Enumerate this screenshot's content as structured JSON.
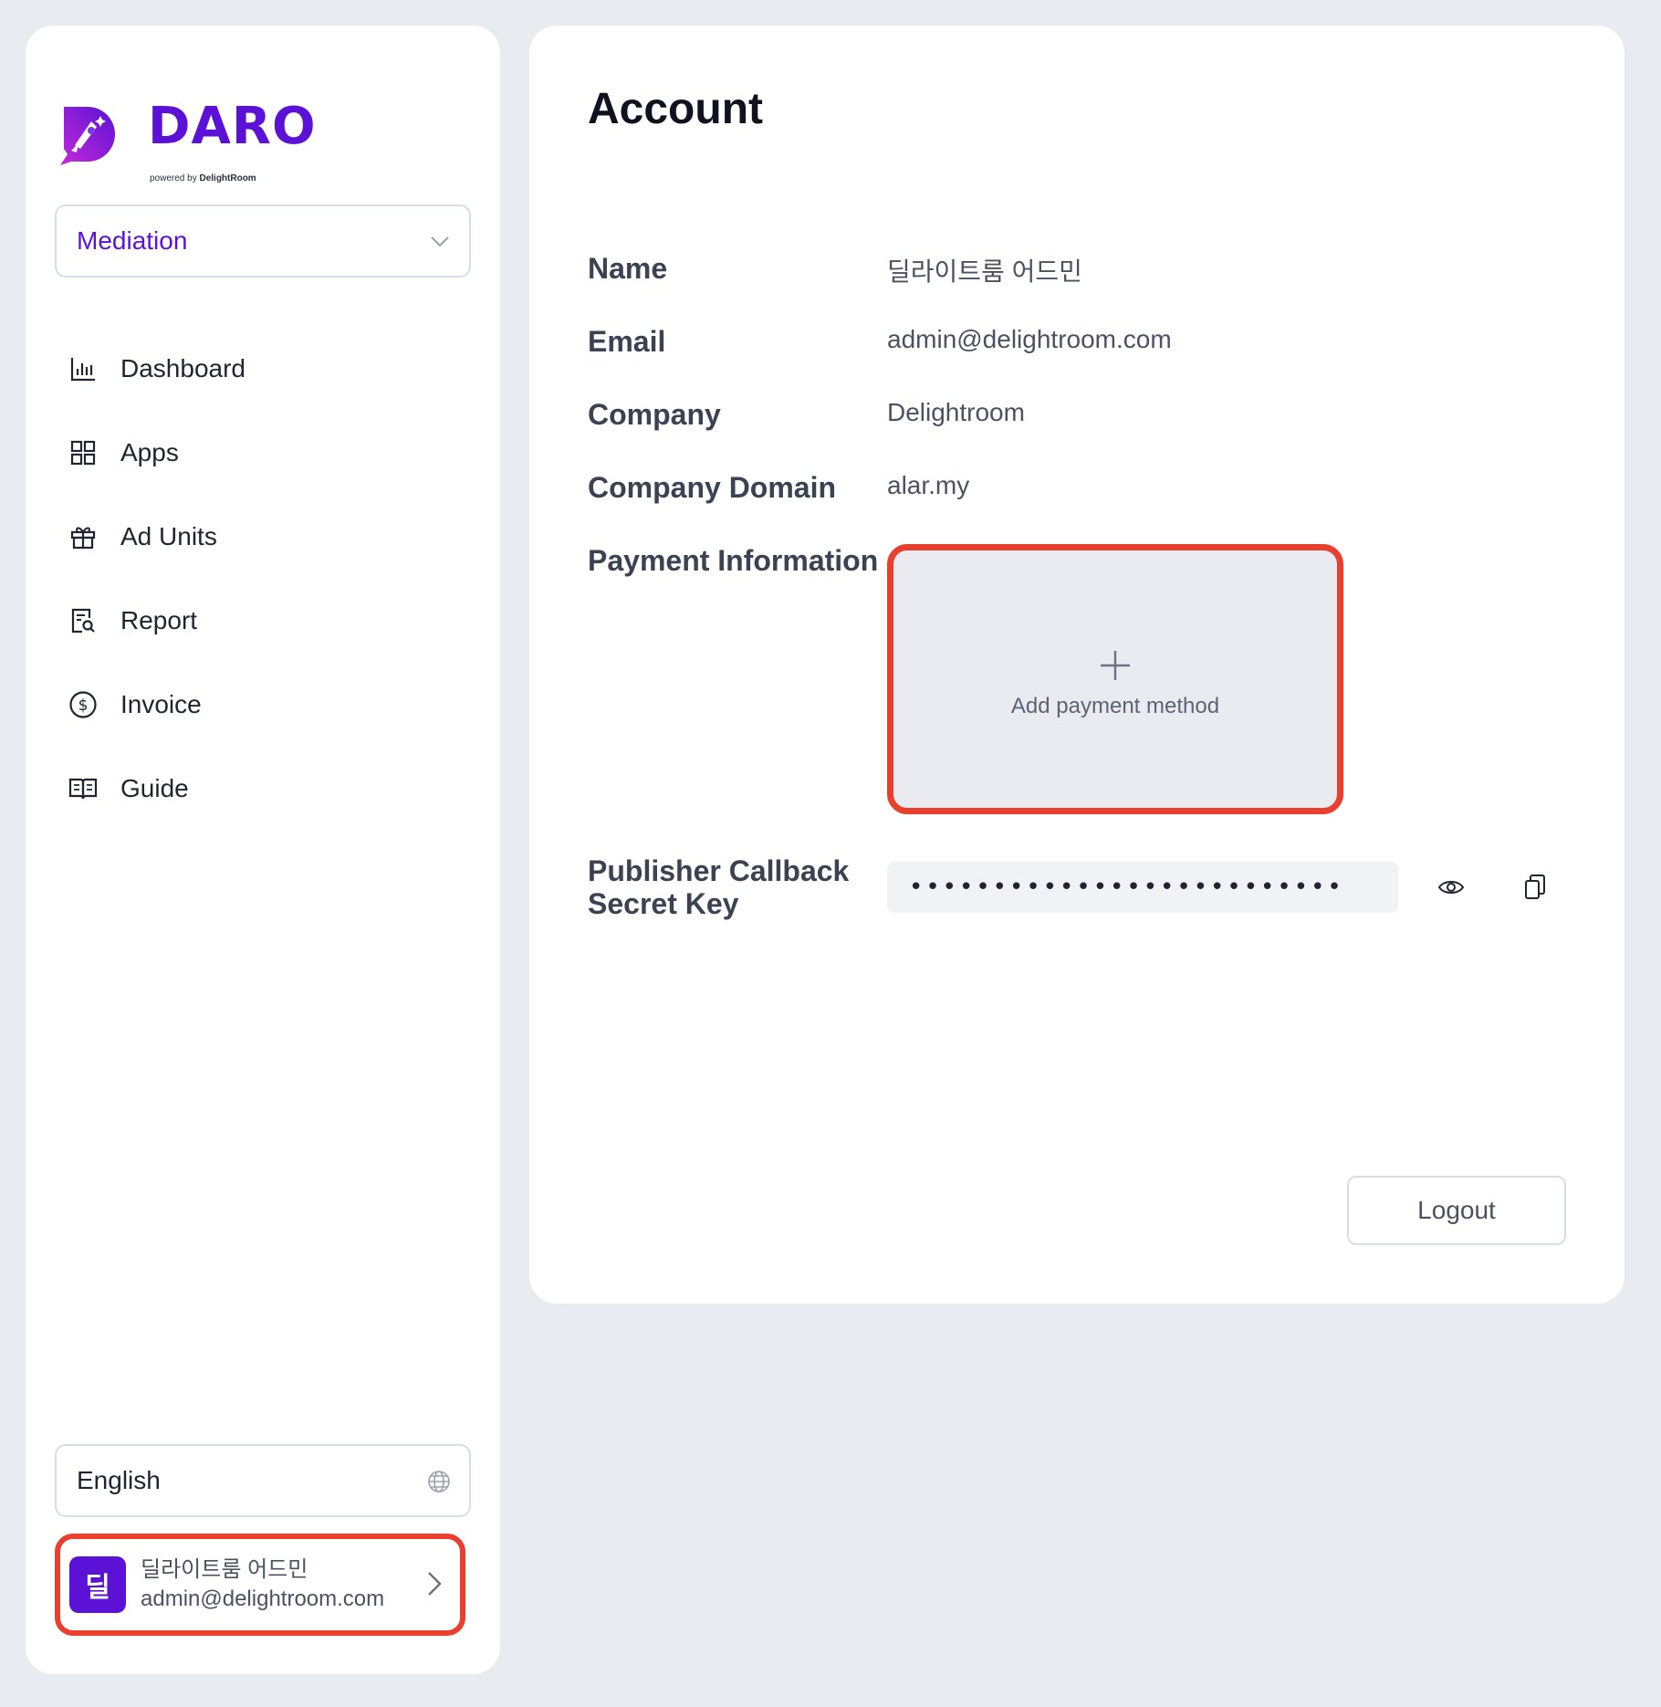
{
  "brand": {
    "name": "DARO",
    "tagline_prefix": "powered by",
    "tagline_company": "DelightRoom",
    "color": "#5b12d6"
  },
  "sidebar": {
    "product_select": {
      "value": "Mediation",
      "icon": "chevron-down-icon"
    },
    "items": [
      {
        "label": "Dashboard",
        "icon": "bar-chart-icon"
      },
      {
        "label": "Apps",
        "icon": "grid-icon"
      },
      {
        "label": "Ad Units",
        "icon": "gift-icon"
      },
      {
        "label": "Report",
        "icon": "report-search-icon"
      },
      {
        "label": "Invoice",
        "icon": "dollar-circle-icon"
      },
      {
        "label": "Guide",
        "icon": "book-icon"
      }
    ],
    "language_select": {
      "value": "English",
      "icon": "globe-icon"
    },
    "user": {
      "avatar_initial": "딜",
      "name": "딜라이트룸 어드민",
      "email": "admin@delightroom.com"
    }
  },
  "account": {
    "title": "Account",
    "fields": {
      "name": {
        "label": "Name",
        "value": "딜라이트룸 어드민"
      },
      "email": {
        "label": "Email",
        "value": "admin@delightroom.com"
      },
      "company": {
        "label": "Company",
        "value": "Delightroom"
      },
      "company_domain": {
        "label": "Company Domain",
        "value": "alar.my"
      },
      "payment": {
        "label": "Payment Information",
        "add_label": "Add payment method"
      },
      "secret": {
        "label_line1": "Publisher Callback",
        "label_line2": "Secret Key",
        "masked_value": "••••••••••••••••••••••••••"
      }
    },
    "logout_label": "Logout"
  },
  "colors": {
    "accent": "#5b12d6",
    "highlight": "#e83f2f",
    "background": "#e8ebf0"
  }
}
